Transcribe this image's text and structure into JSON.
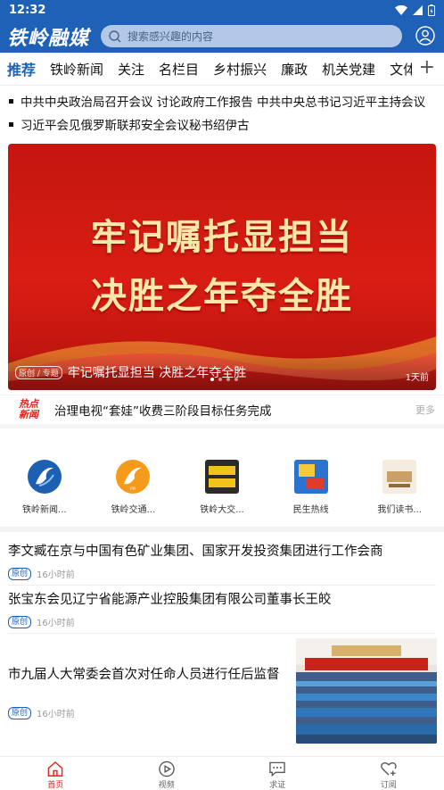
{
  "status_bar": {
    "time": "12:32"
  },
  "header": {
    "logo_text": "铁岭融媒",
    "search_placeholder": "搜索感兴趣的内容"
  },
  "tabs": [
    {
      "label": "推荐",
      "active": true
    },
    {
      "label": "铁岭新闻"
    },
    {
      "label": "关注"
    },
    {
      "label": "名栏目"
    },
    {
      "label": "乡村振兴"
    },
    {
      "label": "廉政"
    },
    {
      "label": "机关党建"
    },
    {
      "label": "文体旅"
    }
  ],
  "headlines": [
    "中共中央政治局召开会议 讨论政府工作报告 中共中央总书记习近平主持会议",
    "习近平会见俄罗斯联邦安全会议秘书绍伊古"
  ],
  "banner": {
    "line1": "牢记嘱托显担当",
    "line2": "决胜之年夺全胜",
    "tag": "原创 / 专题",
    "caption": "牢记嘱托显担当 决胜之年夺全胜",
    "time": "1天前"
  },
  "hot_news": {
    "badge_top": "热点",
    "badge_bottom": "新闻",
    "title": "治理电视“套娃”收费三阶段目标任务完成",
    "more": "更多"
  },
  "grid": [
    {
      "label": "铁岭新闻...",
      "icon": "tieling-news-icon"
    },
    {
      "label": "铁岭交通...",
      "icon": "tieling-traffic-radio-icon"
    },
    {
      "label": "铁岭大交...",
      "icon": "tieling-big-traffic-icon"
    },
    {
      "label": "民生热线",
      "icon": "livelihood-hotline-icon"
    },
    {
      "label": "我们读书...",
      "icon": "reading-icon"
    }
  ],
  "news": [
    {
      "title": "李文臧在京与中国有色矿业集团、国家开发投资集团进行工作会商",
      "tag": "原创",
      "time": "16小时前"
    },
    {
      "title": "张宝东会见辽宁省能源产业控股集团有限公司董事长王皎",
      "tag": "原创",
      "time": "16小时前"
    },
    {
      "title": "市九届人大常委会首次对任命人员进行任后监督",
      "tag": "原创",
      "time": "16小时前"
    }
  ],
  "bottom_nav": [
    {
      "label": "首页",
      "icon": "home-icon",
      "active": true
    },
    {
      "label": "视频",
      "icon": "video-icon"
    },
    {
      "label": "求证",
      "icon": "chat-icon"
    },
    {
      "label": "订阅",
      "icon": "subscribe-heart-icon"
    }
  ],
  "colors": {
    "brand": "#1f61b7",
    "accent": "#e0231c"
  }
}
